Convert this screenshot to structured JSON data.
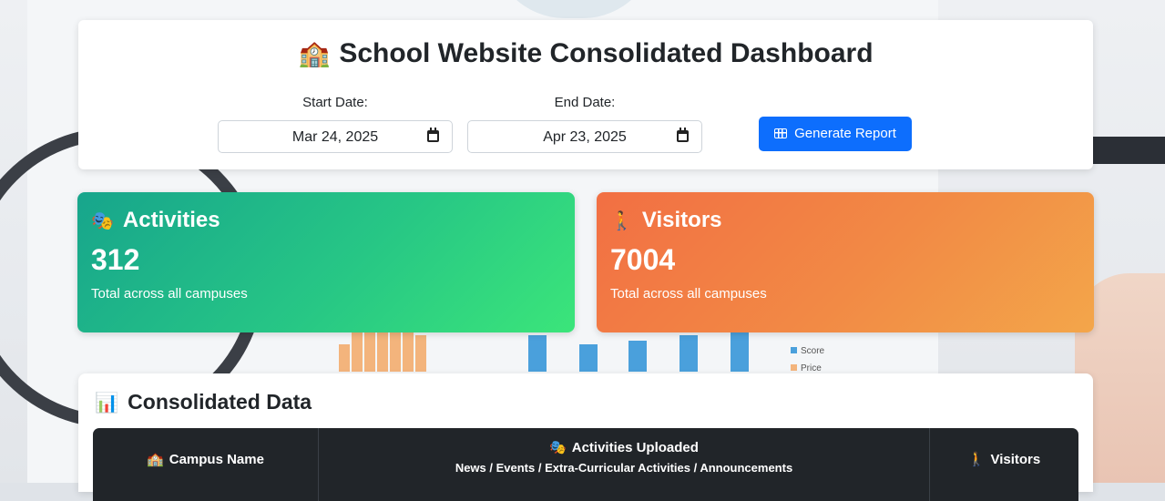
{
  "header": {
    "title_icon": "school-building-emoji",
    "title": "School Website Consolidated Dashboard",
    "start_date": {
      "label": "Start Date:",
      "value": "Mar 24, 2025"
    },
    "end_date": {
      "label": "End Date:",
      "value": "Apr 23, 2025"
    },
    "generate_button": {
      "label": "Generate Report",
      "icon": "table-icon",
      "color": "#0d6efd"
    }
  },
  "stats": {
    "activities": {
      "icon": "performing-arts-emoji",
      "title": "Activities",
      "value": "312",
      "subtitle": "Total across all campuses"
    },
    "visitors": {
      "icon": "person-walking-emoji",
      "title": "Visitors",
      "value": "7004",
      "subtitle": "Total across all campuses"
    }
  },
  "consolidated": {
    "icon": "bar-chart-emoji",
    "title": "Consolidated Data",
    "columns": {
      "campus": {
        "icon": "school-emoji",
        "label": "Campus Name"
      },
      "activities": {
        "icon": "performing-arts-emoji",
        "label": "Activities Uploaded",
        "sublabel": "News / Events / Extra-Curricular Activities / Announcements"
      },
      "visitors": {
        "icon": "person-walking-emoji",
        "label": "Visitors"
      }
    }
  },
  "colors": {
    "activities_gradient": [
      "#17a58c",
      "#3be57a"
    ],
    "visitors_gradient": [
      "#f26f43",
      "#f3a64a"
    ],
    "table_header": "#212529"
  }
}
